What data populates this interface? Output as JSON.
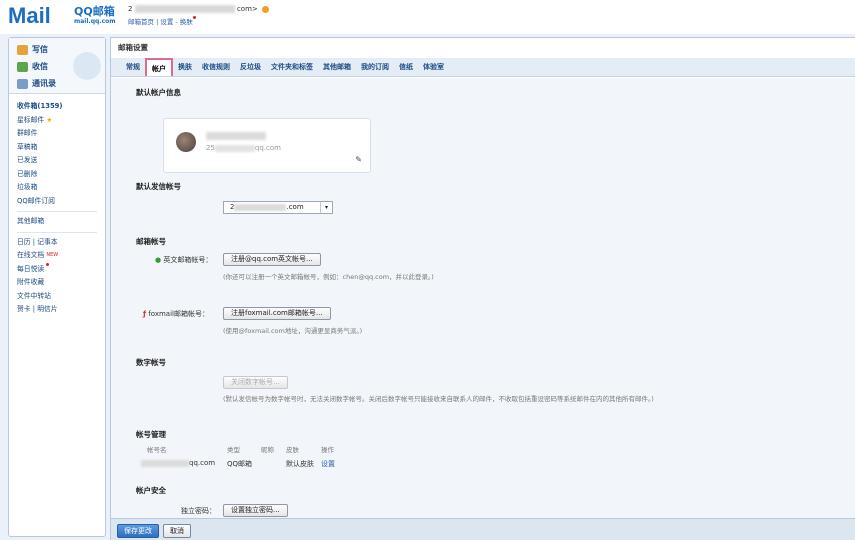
{
  "header": {
    "logo_text": "M",
    "logo_ai": "ail",
    "logo_brand": "QQ邮箱",
    "logo_url": "mail.qq.com",
    "user_prefix": "2",
    "user_suffix": "com>",
    "links": "邮箱首页 | 设置 - 换肤"
  },
  "sidebar": {
    "quick": {
      "compose": "写信",
      "inbox": "收信",
      "contacts": "通讯录"
    },
    "folders": [
      "收件箱(1359)",
      "星标邮件",
      "群邮件",
      "草稿箱",
      "已发送",
      "已删除",
      "垃圾箱",
      "QQ邮件订阅"
    ],
    "other": "其他邮箱",
    "tools": [
      "日历 | 记事本",
      "在线文档",
      "每日悦读",
      "附件收藏",
      "文件中转站",
      "贺卡 | 明信片"
    ],
    "new_badge": "NEW"
  },
  "main": {
    "title": "邮箱设置",
    "tabs": [
      "常规",
      "帐户",
      "换肤",
      "收信规则",
      "反垃圾",
      "文件夹和标签",
      "其他邮箱",
      "我的订阅",
      "信纸",
      "体验室"
    ],
    "sections": {
      "default_info": "默认帐户信息",
      "default_send": "默认发信帐号",
      "mail_account": "邮箱帐号",
      "digital_account": "数字帐号",
      "account_mgmt": "帐号管理",
      "account_security": "帐户安全"
    },
    "card": {
      "email_prefix": "25",
      "email_suffix": "qq.com"
    },
    "default_send_value_prefix": "2",
    "default_send_value_suffix": ".com",
    "english_label": "英文邮箱帐号：",
    "english_button": "注册@qq.com英文帐号...",
    "english_hint": "(你还可以注册一个英文邮箱帐号，例如：chen@qq.com，并以此登录。)",
    "foxmail_label": "foxmail邮箱帐号：",
    "foxmail_button": "注册foxmail.com邮箱帐号...",
    "foxmail_hint": "(使用@foxmail.com地址，沟通更显商务气派。)",
    "digital_button": "关闭数字帐号...",
    "digital_hint": "(默认发信帐号为数字帐号时，无法关闭数字帐号。关闭后数字帐号只能接收来自联系人的邮件，不收取包括重设密码等系统邮件在内的其他所有邮件。)",
    "table": {
      "headers": [
        "帐号名",
        "类型",
        "昵称",
        "皮肤",
        "操作"
      ],
      "row": {
        "name_suffix": "qq.com",
        "type": "QQ邮箱",
        "nickname": "",
        "skin": "默认皮肤",
        "action": "设置"
      }
    },
    "security_label": "独立密码：",
    "security_button": "设置独立密码...",
    "save": "保存更改",
    "cancel": "取消"
  },
  "colors": {
    "brand": "#1a6fc4",
    "tab_active_border": "#e06a8e",
    "link": "#2a5db0"
  }
}
